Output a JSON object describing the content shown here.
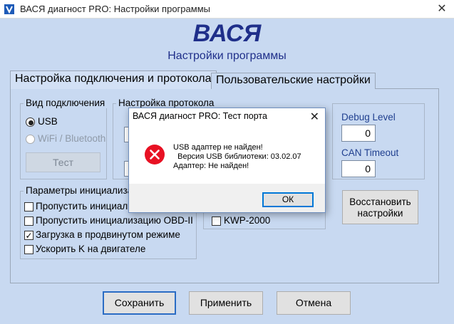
{
  "window": {
    "title": "ВАСЯ диагност PRO:  Настройки программы",
    "close": "✕"
  },
  "header": {
    "brand": "ВАСЯ",
    "subtitle": "Настройки программы"
  },
  "tabs": [
    {
      "label": "Настройка подключения и протокола",
      "active": true
    },
    {
      "label": "Пользовательские настройки",
      "active": false
    }
  ],
  "connection": {
    "group_title": "Вид подключения",
    "options": [
      {
        "label": "USB",
        "selected": true,
        "enabled": true
      },
      {
        "label": "WiFi / Bluetooth",
        "selected": false,
        "enabled": false
      }
    ],
    "test_button": "Тест"
  },
  "protocol": {
    "group_title": "Настройка протокола",
    "kwp_label": "KWP-2000"
  },
  "debug": {
    "debug_level_label": "Debug Level",
    "debug_level_value": "0",
    "can_timeout_label": "CAN Timeout",
    "can_timeout_value": "0"
  },
  "restore_button": {
    "line1": "Восстановить",
    "line2": "настройки"
  },
  "init_params": {
    "group_title": "Параметры инициализа",
    "items": [
      {
        "label": "Пропустить инициализ",
        "checked": false
      },
      {
        "label": "Пропустить инициализацию OBD-II",
        "checked": false
      },
      {
        "label": "Загрузка в продвинутом режиме",
        "checked": true
      },
      {
        "label": "Ускорить K на двигателе",
        "checked": false
      }
    ]
  },
  "footer": {
    "save": "Сохранить",
    "apply": "Применить",
    "cancel": "Отмена"
  },
  "dialog": {
    "title": "ВАСЯ диагност PRO: Тест порта",
    "close": "✕",
    "lines": [
      "USB адаптер не найден!",
      "  Версия USB библиотеки: 03.02.07",
      "Адаптер: Не найден!"
    ],
    "ok": "ОК",
    "icon": "error-icon"
  },
  "colors": {
    "brand": "#1f2f8a",
    "background": "#c8d9f1",
    "error": "#e81123",
    "accent": "#2b6cc4"
  }
}
